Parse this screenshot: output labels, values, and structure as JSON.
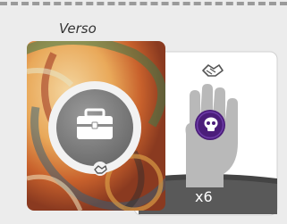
{
  "verso_label": "Verso",
  "card_back": {
    "center_icon": "briefcase-icon",
    "bottom_icon": "handshake-icon",
    "ring_color": "#f2f2f2",
    "disc_color": "#7f7f7f"
  },
  "card_front": {
    "top_icon": "handshake-icon",
    "token_icon": "skull-icon",
    "token_color": "#4b1d7a",
    "hand_color": "#b8b8b8",
    "footer_color": "#5a5a5a",
    "quantity_label": "x6"
  }
}
